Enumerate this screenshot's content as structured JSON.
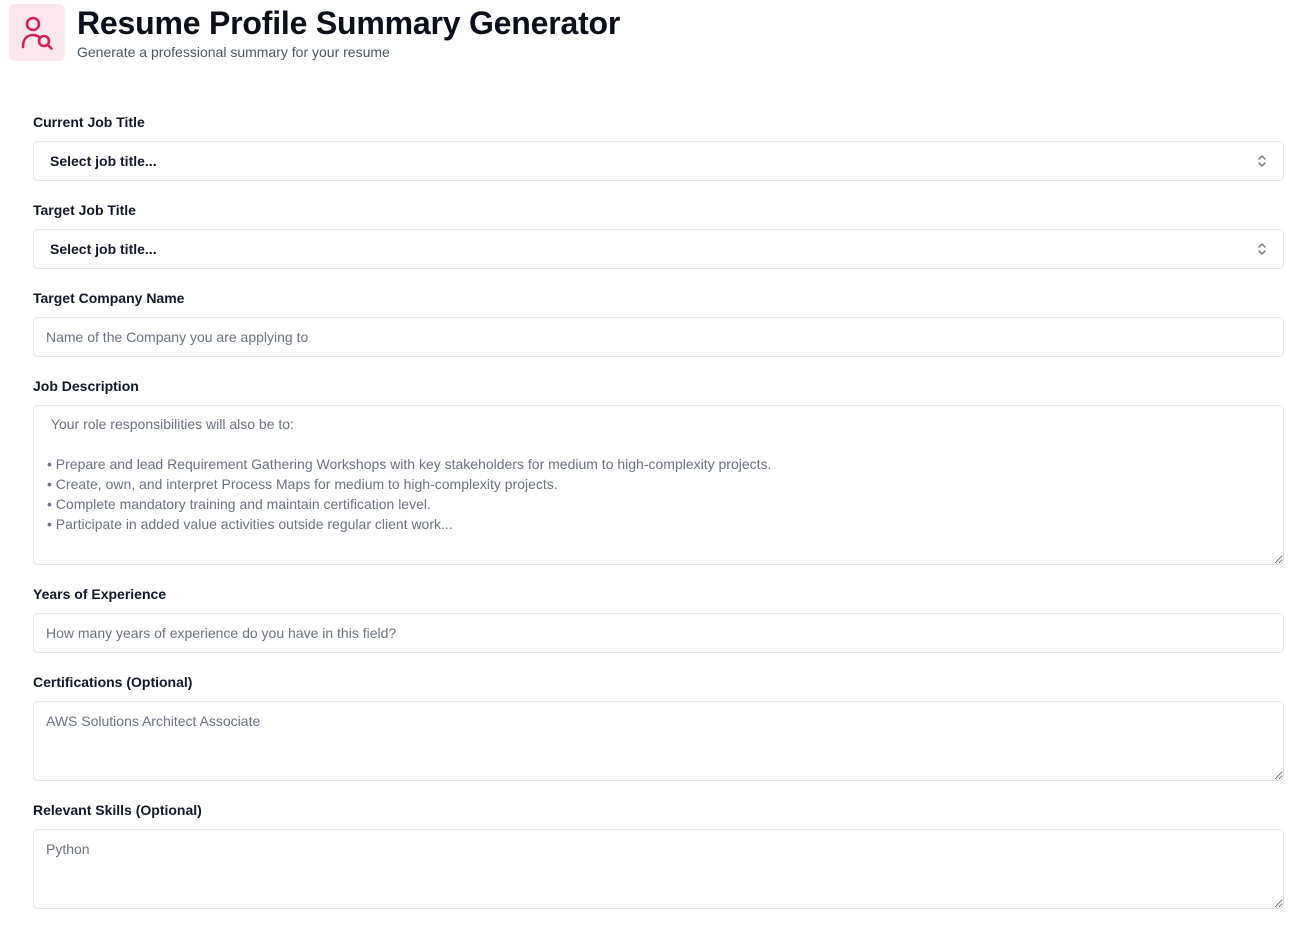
{
  "header": {
    "title": "Resume Profile Summary Generator",
    "subtitle": "Generate a professional summary for your resume",
    "icon": "user-search-icon",
    "accent_color": "#d6215f",
    "icon_bg_color": "#fce7ef"
  },
  "form": {
    "current_job_title": {
      "label": "Current Job Title",
      "value": "Select job title..."
    },
    "target_job_title": {
      "label": "Target Job Title",
      "value": "Select job title..."
    },
    "target_company": {
      "label": "Target Company Name",
      "placeholder": "Name of the Company you are applying to"
    },
    "job_description": {
      "label": "Job Description",
      "placeholder": " Your role responsibilities will also be to:\n\n• Prepare and lead Requirement Gathering Workshops with key stakeholders for medium to high-complexity projects.\n• Create, own, and interpret Process Maps for medium to high-complexity projects.\n• Complete mandatory training and maintain certification level.\n• Participate in added value activities outside regular client work..."
    },
    "years_experience": {
      "label": "Years of Experience",
      "placeholder": "How many years of experience do you have in this field?"
    },
    "certifications": {
      "label": "Certifications (Optional)",
      "placeholder": "AWS Solutions Architect Associate"
    },
    "skills": {
      "label": "Relevant Skills (Optional)",
      "placeholder": "Python"
    }
  }
}
